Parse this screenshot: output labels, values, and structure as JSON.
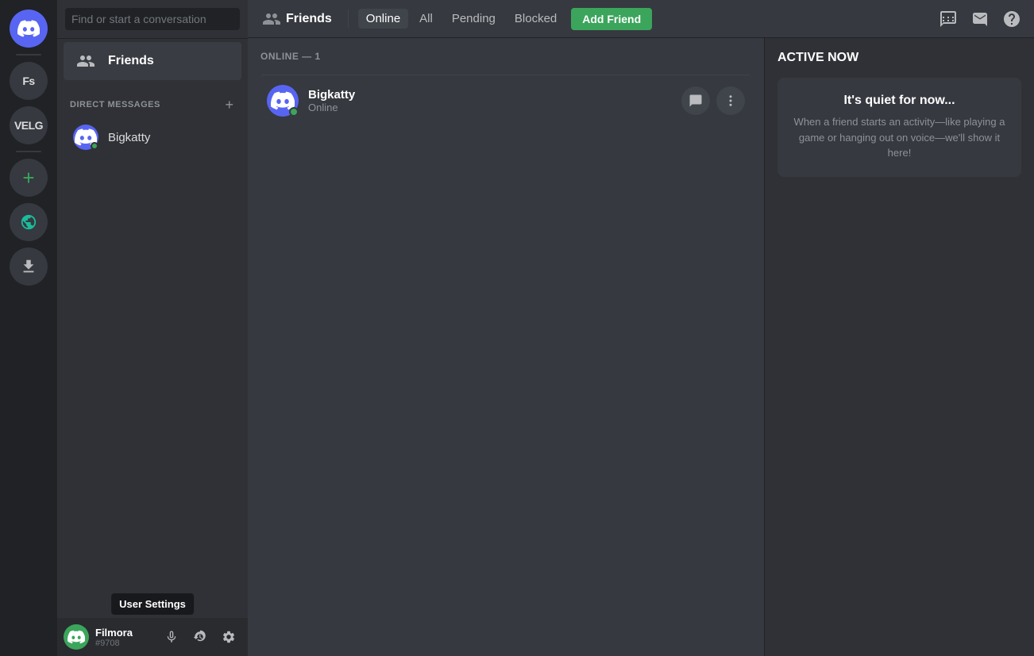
{
  "app": {
    "title": "Discord"
  },
  "server_sidebar": {
    "discord_home_label": "Discord Home",
    "servers": [
      {
        "id": "fs",
        "label": "Fs",
        "type": "text"
      },
      {
        "id": "velg",
        "label": "VELG",
        "type": "text"
      }
    ],
    "add_server_label": "+",
    "explore_label": "🧭",
    "download_label": "⬇"
  },
  "dm_sidebar": {
    "search_placeholder": "Find or start a conversation",
    "friends_label": "Friends",
    "direct_messages_label": "DIRECT MESSAGES",
    "add_dm_label": "+",
    "dm_users": [
      {
        "id": "bigkatty",
        "name": "Bigkatty",
        "status": "online"
      }
    ]
  },
  "user_panel": {
    "username": "Filmora",
    "tag": "#9708",
    "tooltip": "User Settings",
    "mic_label": "🎤",
    "headset_label": "🎧",
    "settings_label": "⚙"
  },
  "top_nav": {
    "friends_icon": "👥",
    "friends_label": "Friends",
    "tabs": [
      {
        "id": "online",
        "label": "Online",
        "active": true
      },
      {
        "id": "all",
        "label": "All",
        "active": false
      },
      {
        "id": "pending",
        "label": "Pending",
        "active": false
      },
      {
        "id": "blocked",
        "label": "Blocked",
        "active": false
      }
    ],
    "add_friend_label": "Add Friend",
    "new_group_dm_icon": "💬+",
    "inbox_icon": "📥",
    "help_icon": "?"
  },
  "friends_list": {
    "online_header": "ONLINE — 1",
    "friends": [
      {
        "id": "bigkatty",
        "name": "Bigkatty",
        "status": "Online",
        "avatar_color": "#5865f2"
      }
    ],
    "message_btn_label": "💬",
    "more_btn_label": "⋮"
  },
  "active_now": {
    "title": "ACTIVE NOW",
    "quiet_title": "It's quiet for now...",
    "quiet_desc": "When a friend starts an activity—like playing a game or hanging out on voice—we'll show it here!"
  }
}
